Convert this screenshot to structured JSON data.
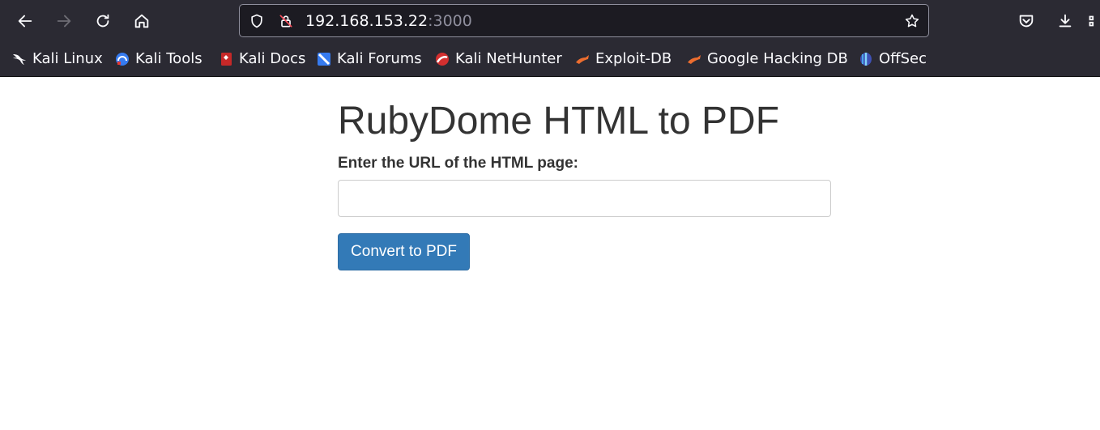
{
  "browser": {
    "url_host": "192.168.153.22",
    "url_port": ":3000",
    "bookmarks": [
      {
        "label": "Kali Linux",
        "icon": "kali-dragon-icon"
      },
      {
        "label": "Kali Tools",
        "icon": "kali-tools-icon"
      },
      {
        "label": "Kali Docs",
        "icon": "kali-docs-icon"
      },
      {
        "label": "Kali Forums",
        "icon": "kali-forums-icon"
      },
      {
        "label": "Kali NetHunter",
        "icon": "kali-nethunter-icon"
      },
      {
        "label": "Exploit-DB",
        "icon": "exploit-db-icon"
      },
      {
        "label": "Google Hacking DB",
        "icon": "google-hacking-db-icon"
      },
      {
        "label": "OffSec",
        "icon": "offsec-icon"
      }
    ],
    "colors": {
      "chrome_bg": "#2b2a33",
      "urlbar_bg": "#1c1b22",
      "text": "#fbfbfe"
    }
  },
  "page": {
    "title": "RubyDome HTML to PDF",
    "url_label": "Enter the URL of the HTML page:",
    "url_input_value": "",
    "convert_label": "Convert to PDF",
    "colors": {
      "primary": "#337ab7",
      "text": "#333333"
    }
  }
}
